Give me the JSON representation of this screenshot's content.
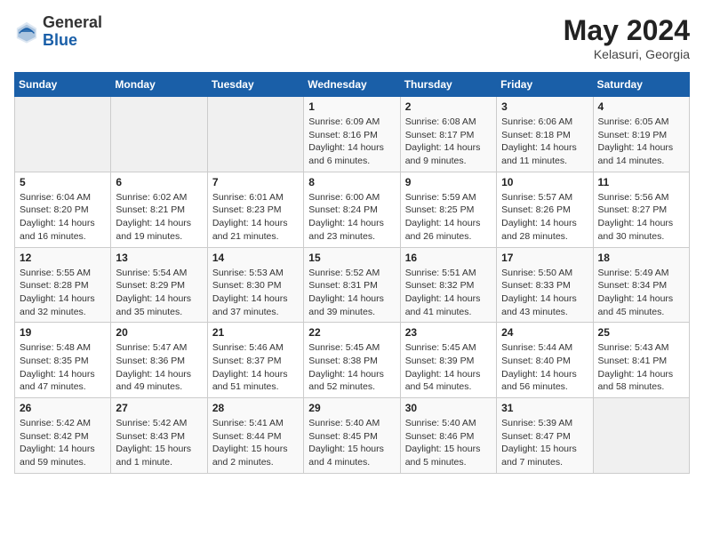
{
  "header": {
    "logo_general": "General",
    "logo_blue": "Blue",
    "month_year": "May 2024",
    "location": "Kelasuri, Georgia"
  },
  "weekdays": [
    "Sunday",
    "Monday",
    "Tuesday",
    "Wednesday",
    "Thursday",
    "Friday",
    "Saturday"
  ],
  "weeks": [
    [
      {
        "day": "",
        "sunrise": "",
        "sunset": "",
        "daylight": ""
      },
      {
        "day": "",
        "sunrise": "",
        "sunset": "",
        "daylight": ""
      },
      {
        "day": "",
        "sunrise": "",
        "sunset": "",
        "daylight": ""
      },
      {
        "day": "1",
        "sunrise": "Sunrise: 6:09 AM",
        "sunset": "Sunset: 8:16 PM",
        "daylight": "Daylight: 14 hours and 6 minutes."
      },
      {
        "day": "2",
        "sunrise": "Sunrise: 6:08 AM",
        "sunset": "Sunset: 8:17 PM",
        "daylight": "Daylight: 14 hours and 9 minutes."
      },
      {
        "day": "3",
        "sunrise": "Sunrise: 6:06 AM",
        "sunset": "Sunset: 8:18 PM",
        "daylight": "Daylight: 14 hours and 11 minutes."
      },
      {
        "day": "4",
        "sunrise": "Sunrise: 6:05 AM",
        "sunset": "Sunset: 8:19 PM",
        "daylight": "Daylight: 14 hours and 14 minutes."
      }
    ],
    [
      {
        "day": "5",
        "sunrise": "Sunrise: 6:04 AM",
        "sunset": "Sunset: 8:20 PM",
        "daylight": "Daylight: 14 hours and 16 minutes."
      },
      {
        "day": "6",
        "sunrise": "Sunrise: 6:02 AM",
        "sunset": "Sunset: 8:21 PM",
        "daylight": "Daylight: 14 hours and 19 minutes."
      },
      {
        "day": "7",
        "sunrise": "Sunrise: 6:01 AM",
        "sunset": "Sunset: 8:23 PM",
        "daylight": "Daylight: 14 hours and 21 minutes."
      },
      {
        "day": "8",
        "sunrise": "Sunrise: 6:00 AM",
        "sunset": "Sunset: 8:24 PM",
        "daylight": "Daylight: 14 hours and 23 minutes."
      },
      {
        "day": "9",
        "sunrise": "Sunrise: 5:59 AM",
        "sunset": "Sunset: 8:25 PM",
        "daylight": "Daylight: 14 hours and 26 minutes."
      },
      {
        "day": "10",
        "sunrise": "Sunrise: 5:57 AM",
        "sunset": "Sunset: 8:26 PM",
        "daylight": "Daylight: 14 hours and 28 minutes."
      },
      {
        "day": "11",
        "sunrise": "Sunrise: 5:56 AM",
        "sunset": "Sunset: 8:27 PM",
        "daylight": "Daylight: 14 hours and 30 minutes."
      }
    ],
    [
      {
        "day": "12",
        "sunrise": "Sunrise: 5:55 AM",
        "sunset": "Sunset: 8:28 PM",
        "daylight": "Daylight: 14 hours and 32 minutes."
      },
      {
        "day": "13",
        "sunrise": "Sunrise: 5:54 AM",
        "sunset": "Sunset: 8:29 PM",
        "daylight": "Daylight: 14 hours and 35 minutes."
      },
      {
        "day": "14",
        "sunrise": "Sunrise: 5:53 AM",
        "sunset": "Sunset: 8:30 PM",
        "daylight": "Daylight: 14 hours and 37 minutes."
      },
      {
        "day": "15",
        "sunrise": "Sunrise: 5:52 AM",
        "sunset": "Sunset: 8:31 PM",
        "daylight": "Daylight: 14 hours and 39 minutes."
      },
      {
        "day": "16",
        "sunrise": "Sunrise: 5:51 AM",
        "sunset": "Sunset: 8:32 PM",
        "daylight": "Daylight: 14 hours and 41 minutes."
      },
      {
        "day": "17",
        "sunrise": "Sunrise: 5:50 AM",
        "sunset": "Sunset: 8:33 PM",
        "daylight": "Daylight: 14 hours and 43 minutes."
      },
      {
        "day": "18",
        "sunrise": "Sunrise: 5:49 AM",
        "sunset": "Sunset: 8:34 PM",
        "daylight": "Daylight: 14 hours and 45 minutes."
      }
    ],
    [
      {
        "day": "19",
        "sunrise": "Sunrise: 5:48 AM",
        "sunset": "Sunset: 8:35 PM",
        "daylight": "Daylight: 14 hours and 47 minutes."
      },
      {
        "day": "20",
        "sunrise": "Sunrise: 5:47 AM",
        "sunset": "Sunset: 8:36 PM",
        "daylight": "Daylight: 14 hours and 49 minutes."
      },
      {
        "day": "21",
        "sunrise": "Sunrise: 5:46 AM",
        "sunset": "Sunset: 8:37 PM",
        "daylight": "Daylight: 14 hours and 51 minutes."
      },
      {
        "day": "22",
        "sunrise": "Sunrise: 5:45 AM",
        "sunset": "Sunset: 8:38 PM",
        "daylight": "Daylight: 14 hours and 52 minutes."
      },
      {
        "day": "23",
        "sunrise": "Sunrise: 5:45 AM",
        "sunset": "Sunset: 8:39 PM",
        "daylight": "Daylight: 14 hours and 54 minutes."
      },
      {
        "day": "24",
        "sunrise": "Sunrise: 5:44 AM",
        "sunset": "Sunset: 8:40 PM",
        "daylight": "Daylight: 14 hours and 56 minutes."
      },
      {
        "day": "25",
        "sunrise": "Sunrise: 5:43 AM",
        "sunset": "Sunset: 8:41 PM",
        "daylight": "Daylight: 14 hours and 58 minutes."
      }
    ],
    [
      {
        "day": "26",
        "sunrise": "Sunrise: 5:42 AM",
        "sunset": "Sunset: 8:42 PM",
        "daylight": "Daylight: 14 hours and 59 minutes."
      },
      {
        "day": "27",
        "sunrise": "Sunrise: 5:42 AM",
        "sunset": "Sunset: 8:43 PM",
        "daylight": "Daylight: 15 hours and 1 minute."
      },
      {
        "day": "28",
        "sunrise": "Sunrise: 5:41 AM",
        "sunset": "Sunset: 8:44 PM",
        "daylight": "Daylight: 15 hours and 2 minutes."
      },
      {
        "day": "29",
        "sunrise": "Sunrise: 5:40 AM",
        "sunset": "Sunset: 8:45 PM",
        "daylight": "Daylight: 15 hours and 4 minutes."
      },
      {
        "day": "30",
        "sunrise": "Sunrise: 5:40 AM",
        "sunset": "Sunset: 8:46 PM",
        "daylight": "Daylight: 15 hours and 5 minutes."
      },
      {
        "day": "31",
        "sunrise": "Sunrise: 5:39 AM",
        "sunset": "Sunset: 8:47 PM",
        "daylight": "Daylight: 15 hours and 7 minutes."
      },
      {
        "day": "",
        "sunrise": "",
        "sunset": "",
        "daylight": ""
      }
    ]
  ]
}
